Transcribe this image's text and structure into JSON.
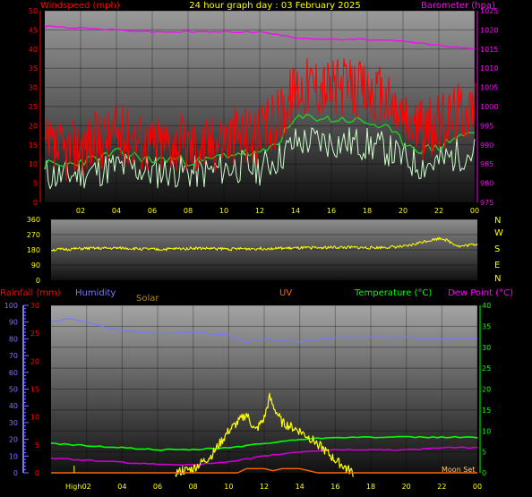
{
  "title": "24 hour graph day : 03 February 2025",
  "colors": {
    "windspeed": "#ff0000",
    "barometer": "#ff00ff",
    "gust_avg": "#22cc22",
    "wind_light": "#ccffcc",
    "direction": "#ffff00",
    "rainfall": "#ff0000",
    "humidity": "#7777ff",
    "solar": "#ffff00",
    "uv": "#ff6600",
    "temperature": "#00ff00",
    "dewpoint": "#cc00cc",
    "axis_text": "#ffff00"
  },
  "legend": {
    "windspeed": "Windspeed (mph)",
    "barometer": "Barometer (hpa)",
    "rainfall": "Rainfall (mm)",
    "humidity": "Humidity",
    "solar": "Solar",
    "uv": "UV",
    "temperature": "Temperature (°C)",
    "dewpoint": "Dew Point (°C)"
  },
  "compass": [
    "N",
    "W",
    "S",
    "E",
    "N"
  ],
  "annotations": {
    "high": "High",
    "moon_set": "Moon Set"
  },
  "chart_data": [
    {
      "type": "line",
      "title": "24 hour graph day : 03 February 2025",
      "x_ticks": [
        "02",
        "04",
        "06",
        "08",
        "10",
        "12",
        "14",
        "16",
        "18",
        "20",
        "22",
        "00"
      ],
      "y_left": {
        "label": "Windspeed (mph)",
        "ticks": [
          0,
          5,
          10,
          15,
          20,
          25,
          30,
          35,
          40,
          45,
          50
        ],
        "range": [
          0,
          50
        ]
      },
      "y_right": {
        "label": "Barometer (hpa)",
        "ticks": [
          975,
          980,
          985,
          990,
          995,
          1000,
          1005,
          1010,
          1015,
          1020,
          1025
        ],
        "range": [
          975,
          1025
        ]
      },
      "series": [
        {
          "name": "Windspeed (mph)",
          "x": [
            0,
            1,
            2,
            3,
            4,
            5,
            6,
            7,
            8,
            9,
            10,
            11,
            12,
            13,
            14,
            15,
            16,
            17,
            18,
            19,
            20,
            21,
            22,
            23,
            24
          ],
          "values": [
            14,
            13,
            15,
            16,
            18,
            17,
            15,
            16,
            15,
            15,
            17,
            18,
            17,
            22,
            30,
            31,
            30,
            30,
            29,
            27,
            22,
            19,
            20,
            24,
            25
          ]
        },
        {
          "name": "Barometer (hpa)",
          "x": [
            0,
            2,
            4,
            6,
            8,
            10,
            12,
            14,
            16,
            18,
            20,
            22,
            24
          ],
          "values": [
            1021,
            1020.5,
            1020,
            1019.5,
            1019.5,
            1019.5,
            1019.5,
            1018,
            1017.5,
            1017.5,
            1017,
            1016,
            1015
          ]
        }
      ]
    },
    {
      "type": "line",
      "y_left": {
        "ticks": [
          0,
          90,
          180,
          270,
          360
        ],
        "range": [
          0,
          360
        ]
      },
      "series": [
        {
          "x": [
            0,
            2,
            4,
            6,
            8,
            10,
            12,
            14,
            16,
            18,
            20,
            21,
            22,
            23,
            24
          ],
          "values": [
            180,
            188,
            190,
            182,
            190,
            185,
            188,
            190,
            195,
            192,
            200,
            230,
            250,
            200,
            215
          ]
        }
      ]
    },
    {
      "type": "line",
      "x_ticks": [
        "02",
        "04",
        "06",
        "08",
        "10",
        "12",
        "14",
        "16",
        "18",
        "20",
        "22",
        "00"
      ],
      "y_humidity": {
        "ticks": [
          0,
          10,
          20,
          30,
          40,
          50,
          60,
          70,
          80,
          90,
          100
        ],
        "range": [
          0,
          100
        ]
      },
      "y_rainfall": {
        "label": "Rainfall (mm)",
        "ticks": [
          0,
          5,
          10,
          15,
          20,
          25,
          30
        ],
        "range": [
          0,
          30
        ]
      },
      "y_temperature": {
        "label": "Temperature (°C)",
        "ticks": [
          0,
          5,
          10,
          15,
          20,
          25,
          30,
          35,
          40
        ],
        "range": [
          0,
          40
        ]
      },
      "series": [
        {
          "name": "Humidity",
          "x": [
            0,
            1,
            2,
            3,
            4,
            6,
            8,
            10,
            11,
            12,
            14,
            16,
            18,
            20,
            22,
            24
          ],
          "values": [
            90,
            92,
            90,
            87,
            85,
            83,
            84,
            82,
            78,
            80,
            78,
            81,
            81,
            81,
            80,
            80
          ]
        },
        {
          "name": "Temperature (°C)",
          "x": [
            0,
            2,
            4,
            6,
            8,
            10,
            12,
            14,
            16,
            18,
            20,
            22,
            24
          ],
          "values": [
            7,
            6.5,
            6,
            5.5,
            5.5,
            6,
            7,
            8,
            8.5,
            8.5,
            8.5,
            8.5,
            8.5
          ]
        },
        {
          "name": "Dew Point (°C)",
          "x": [
            0,
            2,
            4,
            6,
            8,
            10,
            12,
            14,
            16,
            18,
            20,
            22,
            24
          ],
          "values": [
            3.5,
            3,
            2.5,
            2,
            2,
            2.5,
            4,
            5,
            5.5,
            5.5,
            5.5,
            6,
            6
          ]
        },
        {
          "name": "Solar",
          "x": [
            7,
            8,
            9,
            10,
            10.5,
            11,
            11.5,
            12,
            12.3,
            12.5,
            13,
            14,
            15,
            16,
            17
          ],
          "values": [
            0,
            1,
            4,
            10,
            12,
            14,
            10,
            13,
            18,
            16,
            12,
            10,
            7,
            3,
            0
          ]
        },
        {
          "name": "UV",
          "x": [
            0,
            10.5,
            11,
            12,
            12.5,
            13,
            14,
            14.5,
            15,
            24
          ],
          "values": [
            0,
            0,
            1,
            1,
            0.5,
            1,
            1,
            0.5,
            0,
            0
          ]
        }
      ]
    }
  ]
}
